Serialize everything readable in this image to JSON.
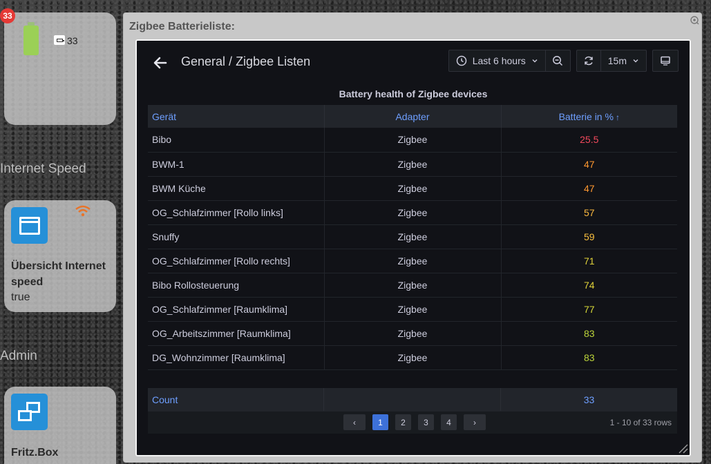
{
  "sidebar_tiles": {
    "battery": {
      "notification_count": "33",
      "value": "33",
      "icon": "battery-full-icon"
    },
    "internet_section_title": "Internet Speed",
    "internet": {
      "label": "Übersicht Internet speed",
      "value": "true",
      "icon": "window-icon",
      "status_icon": "wifi-icon",
      "accent_color": "#2590d8"
    },
    "admin_section_title": "Admin",
    "fritz": {
      "label": "Fritz.Box",
      "icon": "network-windows-icon"
    }
  },
  "dialog": {
    "title": "Zigbee Batterieliste:"
  },
  "dashboard": {
    "breadcrumb_root": "General",
    "breadcrumb_sep": " / ",
    "breadcrumb_page": "Zigbee Listen",
    "time_range": "Last 6 hours",
    "refresh_interval": "15m"
  },
  "panel": {
    "title": "Battery health of Zigbee devices",
    "columns": [
      "Gerät",
      "Adapter",
      "Batterie in %"
    ],
    "sort_indicator": "↑",
    "rows": [
      {
        "device": "Bibo",
        "adapter": "Zigbee",
        "battery": "25.5",
        "color": "#f2495c"
      },
      {
        "device": "BWM-1",
        "adapter": "Zigbee",
        "battery": "47",
        "color": "#ff9830"
      },
      {
        "device": "BWM Küche",
        "adapter": "Zigbee",
        "battery": "47",
        "color": "#ff9830"
      },
      {
        "device": "OG_Schlafzimmer [Rollo links]",
        "adapter": "Zigbee",
        "battery": "57",
        "color": "#fab83f"
      },
      {
        "device": "Snuffy",
        "adapter": "Zigbee",
        "battery": "59",
        "color": "#fac03f"
      },
      {
        "device": "OG_Schlafzimmer [Rollo rechts]",
        "adapter": "Zigbee",
        "battery": "71",
        "color": "#e0d23a"
      },
      {
        "device": "Bibo Rollosteuerung",
        "adapter": "Zigbee",
        "battery": "74",
        "color": "#e0d23a"
      },
      {
        "device": "OG_Schlafzimmer [Raumklima]",
        "adapter": "Zigbee",
        "battery": "77",
        "color": "#d6d838"
      },
      {
        "device": "OG_Arbeitszimmer [Raumklima]",
        "adapter": "Zigbee",
        "battery": "83",
        "color": "#bcd43a"
      },
      {
        "device": "DG_Wohnzimmer [Raumklima]",
        "adapter": "Zigbee",
        "battery": "83",
        "color": "#bcd43a"
      }
    ],
    "footer": {
      "label": "Count",
      "value": "33"
    },
    "pagination": {
      "pages": [
        "1",
        "2",
        "3",
        "4"
      ],
      "active_page": "1",
      "rows_info": "1 - 10 of 33 rows"
    }
  }
}
